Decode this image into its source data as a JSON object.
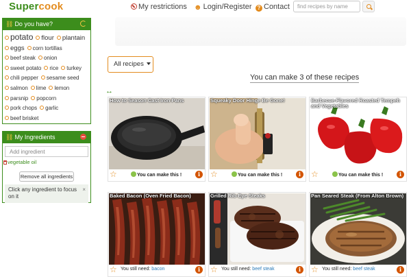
{
  "header": {
    "logo_a": "Super",
    "logo_b": "cook",
    "nav": {
      "restrictions": "My restrictions",
      "login": "Login/Register",
      "contact": "Contact"
    },
    "search": {
      "placeholder": "find recipes by name"
    }
  },
  "pantry": {
    "title": "Do you have?",
    "items": [
      {
        "label": "potato",
        "size": "big"
      },
      {
        "label": "flour",
        "size": "mid"
      },
      {
        "label": "plantain",
        "size": "mid"
      },
      {
        "label": "eggs",
        "size": "mid"
      },
      {
        "label": "corn tortillas",
        "size": "small"
      },
      {
        "label": "beef steak",
        "size": "small"
      },
      {
        "label": "onion",
        "size": "small"
      },
      {
        "label": "sweet potato",
        "size": "small"
      },
      {
        "label": "rice",
        "size": "small"
      },
      {
        "label": "turkey",
        "size": "small"
      },
      {
        "label": "chili pepper",
        "size": "small"
      },
      {
        "label": "sesame seed",
        "size": "small"
      },
      {
        "label": "salmon",
        "size": "small"
      },
      {
        "label": "lime",
        "size": "small"
      },
      {
        "label": "lemon",
        "size": "small"
      },
      {
        "label": "parsnip",
        "size": "small"
      },
      {
        "label": "popcorn",
        "size": "small"
      },
      {
        "label": "pork chops",
        "size": "small"
      },
      {
        "label": "garlic",
        "size": "small"
      },
      {
        "label": "beef brisket",
        "size": "small"
      }
    ]
  },
  "my_ingredients": {
    "title": "My Ingredients",
    "add_placeholder": "Add ingredient",
    "items": [
      "vegetable oil"
    ],
    "remove_all": "Remove all ingredients",
    "hint": "Click any ingredient to focus on it",
    "hint_close": "×"
  },
  "main": {
    "filter_label": "All recipes",
    "summary": "You can make 3 of these recipes",
    "recipes": [
      {
        "title": "How to Season Cast Iron Pans",
        "status": "can",
        "status_text": "You can make this !",
        "need_prefix": "",
        "need_item": "",
        "image": "pan-photo"
      },
      {
        "title": "Squeaky Door Hinge Be Gone!",
        "status": "can",
        "status_text": "You can make this !",
        "need_prefix": "",
        "need_item": "",
        "image": "hinge-photo"
      },
      {
        "title": "Barbecue-Flavored Roasted Tempeh and Vegetables",
        "status": "can",
        "status_text": "You can make this !",
        "need_prefix": "",
        "need_item": "",
        "image": "peppers-photo"
      },
      {
        "title": "Baked Bacon (Oven Fried Bacon)",
        "status": "need",
        "status_text": "",
        "need_prefix": "You still need:",
        "need_item": "bacon",
        "image": "bacon-photo"
      },
      {
        "title": "Grilled Rib-Eye Steaks",
        "status": "need",
        "status_text": "",
        "need_prefix": "You still need:",
        "need_item": "beef steak",
        "image": "steak-photo"
      },
      {
        "title": "Pan Seared Steak (From Alton Brown)",
        "status": "need",
        "status_text": "",
        "need_prefix": "You still need:",
        "need_item": "beef steak",
        "image": "seared-steak-photo"
      }
    ]
  },
  "colors": {
    "brand_green": "#3c8d1c",
    "brand_orange": "#e38b1d",
    "info_red": "#d35400",
    "link_blue": "#2a7ab8"
  }
}
